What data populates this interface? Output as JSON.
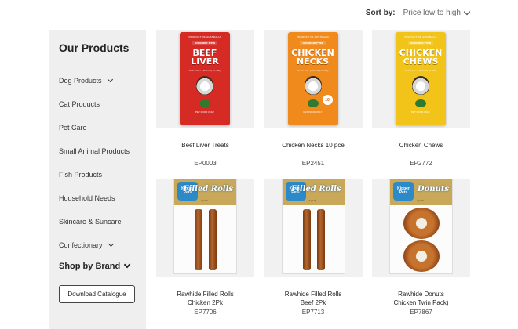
{
  "sort": {
    "label": "Sort by:",
    "value": "Price low to high"
  },
  "sidebar": {
    "title": "Our Products",
    "items": [
      {
        "label": "Dog Products",
        "has_chevron": true
      },
      {
        "label": "Cat Products",
        "has_chevron": false
      },
      {
        "label": "Pet Care",
        "has_chevron": false
      },
      {
        "label": "Small Animal Products",
        "has_chevron": false
      },
      {
        "label": "Fish Products",
        "has_chevron": false
      },
      {
        "label": "Household Needs",
        "has_chevron": false
      },
      {
        "label": "Skincare & Suncare",
        "has_chevron": false
      },
      {
        "label": "Confectionary",
        "has_chevron": true
      }
    ],
    "brand_label": "Shop by Brand",
    "download_label": "Download Catalogue"
  },
  "products": [
    {
      "name": "Beef Liver Treats",
      "code": "EP0003",
      "pack": {
        "style": "bag",
        "color": "#d62b25",
        "small": "PRODUCT OF AUSTRALIA",
        "brandmark": "Smookie Pets",
        "title": [
          "BEEF",
          "LIVER"
        ],
        "tag": "Gluten Free | Natural | Healthy",
        "foot": "PET FOOD ONLY"
      }
    },
    {
      "name": "Chicken Necks 10 pce",
      "code": "EP2451",
      "pack": {
        "style": "bag",
        "color": "#f08a1c",
        "small": "PRODUCT OF AUSTRALIA",
        "brandmark": "Smookie Pets",
        "title": [
          "CHICKEN",
          "NECKS"
        ],
        "tag": "Gluten Free | Natural | Healthy",
        "badge": "10",
        "foot": "PET FOOD ONLY"
      }
    },
    {
      "name": "Chicken Chews",
      "code": "EP2772",
      "pack": {
        "style": "bag",
        "color": "#f2c318",
        "small": "PRODUCT OF AUSTRALIA",
        "brandmark": "Smookie Pets",
        "title": [
          "CHICKEN",
          "CHEWS"
        ],
        "tag": "Gluten Free | Natural | Healthy",
        "foot": "PET FOOD ONLY"
      }
    },
    {
      "name": [
        "Rawhide Filled Rolls",
        "Chicken 2Pk"
      ],
      "code": "EP7706",
      "pack": {
        "style": "rolls",
        "logo": [
          "Kipper",
          "Pets"
        ],
        "title": "Filled Rolls",
        "count": "2 pack"
      }
    },
    {
      "name": [
        "Rawhide Filled Rolls",
        "Beef 2Pk"
      ],
      "code": "EP7713",
      "pack": {
        "style": "rolls",
        "logo": [
          "Kipper",
          "Pets"
        ],
        "title": "Filled Rolls",
        "count": "2 pack"
      }
    },
    {
      "name": [
        "Rawhide Donuts",
        "Chicken Twin Pack)"
      ],
      "code": "EP7867",
      "pack": {
        "style": "donuts",
        "logo": [
          "Kipper",
          "Pets"
        ],
        "title": "Donuts",
        "count": "2 pack"
      }
    }
  ],
  "colors": {
    "sidebar_bg": "#efefef",
    "thumb_bg": "#f1f1f1"
  }
}
